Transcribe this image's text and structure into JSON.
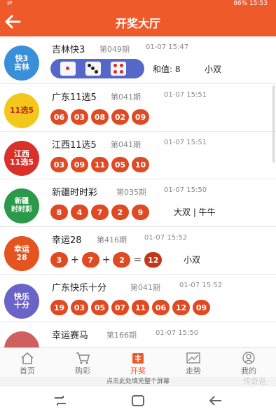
{
  "status_bar": {
    "left": "⇄",
    "right": "86% 15:53"
  },
  "header": {
    "title": "开奖大厅"
  },
  "lotteries": [
    {
      "logo_text": "快3\n吉林",
      "logo_color": "#3a8fd9",
      "name": "吉林快3",
      "period": "第049期",
      "time": "01-07 15:47",
      "sum": "和值: 8",
      "tag": "小双"
    },
    {
      "logo_text": "11选5",
      "logo_color": "#f3c81a",
      "name": "广东11选5",
      "period": "第041期",
      "time": "01-07 15:51",
      "balls": [
        "06",
        "03",
        "08",
        "02",
        "09"
      ]
    },
    {
      "logo_text": "江西\n11选5",
      "logo_color": "#d9302a",
      "name": "江西11选5",
      "period": "第041期",
      "time": "01-07 15:51",
      "balls": [
        "03",
        "09",
        "11",
        "05",
        "10"
      ]
    },
    {
      "logo_text": "新疆\n时时彩",
      "logo_color": "#2a9a4a",
      "name": "新疆时时彩",
      "period": "第035期",
      "time": "01-07 15:50",
      "balls": [
        "8",
        "4",
        "7",
        "2",
        "9"
      ],
      "result": "大双 | 牛牛"
    },
    {
      "logo_text": "幸运\n28",
      "logo_color": "#e4541e",
      "name": "幸运28",
      "period": "第416期",
      "time": "01-07 15:52",
      "balls": [
        "3",
        "7",
        "2"
      ],
      "sum": "12",
      "tag": "小双"
    },
    {
      "logo_text": "快乐\n十分",
      "logo_color": "#6b64c8",
      "name": "广东快乐十分",
      "period": "第041期",
      "time": "01-07 15:52",
      "balls": [
        "19",
        "03",
        "05",
        "07",
        "11",
        "06",
        "12",
        "09"
      ]
    },
    {
      "logo_text": "",
      "logo_color": "#d06060",
      "name": "幸运赛马",
      "period": "第166期",
      "time": "01-07 15:50"
    }
  ],
  "tabs": [
    {
      "label": "首页",
      "icon": "home-icon"
    },
    {
      "label": "购彩",
      "icon": "cart-icon"
    },
    {
      "label": "开奖",
      "icon": "lottery-draw-icon"
    },
    {
      "label": "走势",
      "icon": "trend-icon"
    },
    {
      "label": "我的",
      "icon": "profile-icon"
    }
  ],
  "hint": {
    "text": "点击此处填充整个屏幕",
    "watermark": "传奇返"
  },
  "colors": {
    "primary": "#ef5a2a",
    "ball": "#e04a22",
    "dice_pill": "#5567c8"
  }
}
